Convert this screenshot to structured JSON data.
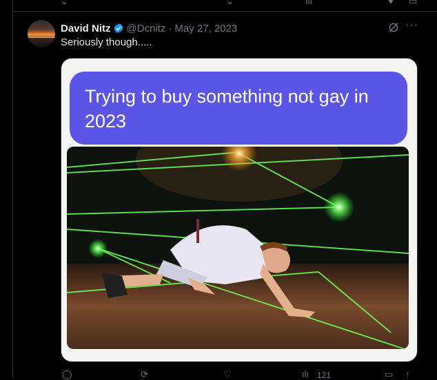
{
  "tweet": {
    "author_name": "David Nitz",
    "handle": "@Dcnitz",
    "separator": "·",
    "date": "May 27, 2023",
    "text": "Seriously though.....",
    "more_glyph": "···"
  },
  "media": {
    "caption_line1": "Trying to buy something not gay in",
    "caption_line2": "2023"
  },
  "footer": {
    "views_partial": "121"
  },
  "icons": {
    "top": [
      "reply-icon",
      "bookmark-icon",
      "share-icon",
      "heart-icon"
    ],
    "bottom": [
      "reply-icon",
      "retweet-icon",
      "like-icon",
      "views-icon",
      "bookmark-icon",
      "share-icon"
    ]
  },
  "colors": {
    "background": "#000000",
    "text_primary": "#e7e9ea",
    "text_secondary": "#71767b",
    "verified_blue": "#1d9bf0",
    "bubble_purple": "#5b55e6",
    "laser_green": "#6cff5a"
  }
}
